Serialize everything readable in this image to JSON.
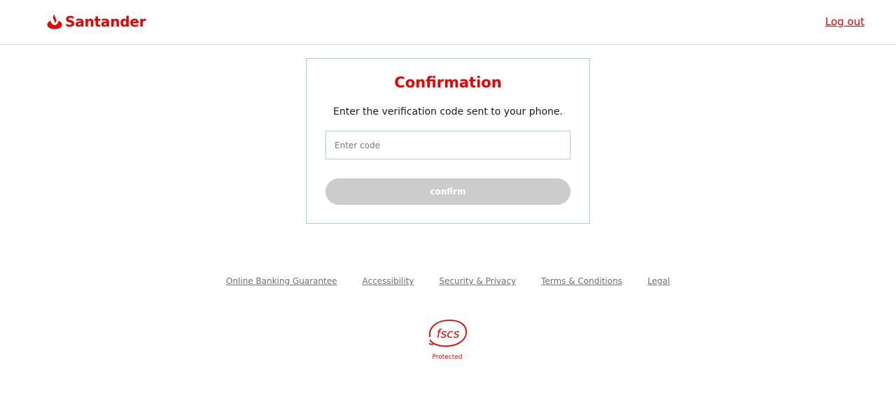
{
  "header": {
    "brand_name": "Santander",
    "logout_label": "Log out"
  },
  "card": {
    "title": "Confirmation",
    "subtitle": "Enter the verification code sent to your phone.",
    "code_input": {
      "placeholder": "Enter code",
      "value": ""
    },
    "confirm_label": "confirm"
  },
  "footer": {
    "links": [
      "Online Banking Guarantee",
      "Accessibility",
      "Security & Privacy",
      "Terms & Conditions",
      "Legal"
    ],
    "badge_text": "fscs",
    "badge_caption": "Protected"
  },
  "colors": {
    "brand_red": "#ec0000",
    "border": "#a9d3d6",
    "button_disabled": "#cccccc",
    "link_gray": "#6f6f6f"
  }
}
